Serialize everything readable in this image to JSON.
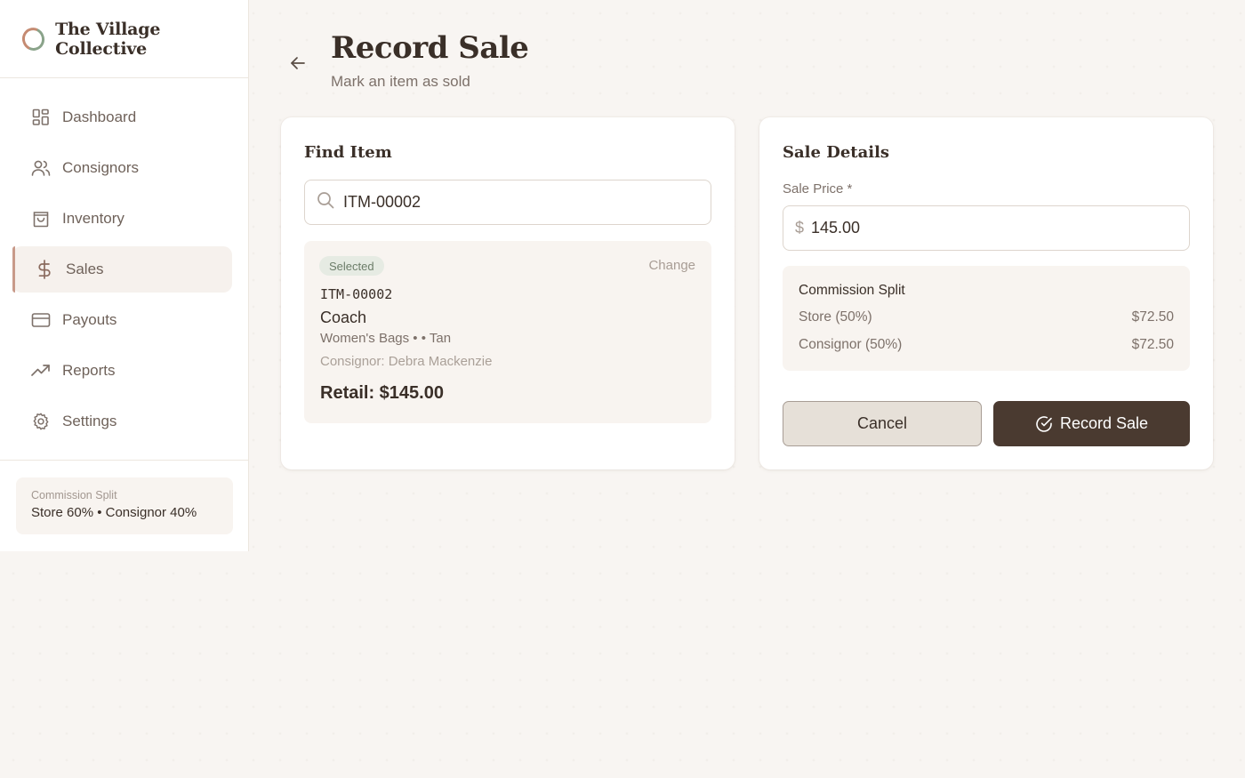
{
  "brand": {
    "name": "The Village Collective"
  },
  "nav": {
    "items": [
      {
        "label": "Dashboard",
        "icon": "dashboard-icon"
      },
      {
        "label": "Consignors",
        "icon": "users-icon"
      },
      {
        "label": "Inventory",
        "icon": "shopping-bag-icon"
      },
      {
        "label": "Sales",
        "icon": "dollar-icon",
        "active": true
      },
      {
        "label": "Payouts",
        "icon": "credit-card-icon"
      },
      {
        "label": "Reports",
        "icon": "trending-up-icon"
      },
      {
        "label": "Settings",
        "icon": "gear-icon"
      }
    ]
  },
  "sidebar_footer": {
    "label": "Commission Split",
    "value": "Store 60% • Consignor 40%"
  },
  "header": {
    "title": "Record Sale",
    "subtitle": "Mark an item as sold"
  },
  "find_item": {
    "title": "Find Item",
    "search_value": "ITM-00002",
    "selected": {
      "badge": "Selected",
      "change_label": "Change",
      "sku": "ITM-00002",
      "brand": "Coach",
      "meta": "Women's Bags • • Tan",
      "consignor": "Consignor: Debra Mackenzie",
      "retail": "Retail: $145.00"
    }
  },
  "sale_details": {
    "title": "Sale Details",
    "price_label": "Sale Price *",
    "currency_symbol": "$",
    "price_value": "145.00",
    "split": {
      "title": "Commission Split",
      "store_label": "Store (50%)",
      "store_value": "$72.50",
      "consignor_label": "Consignor (50%)",
      "consignor_value": "$72.50"
    },
    "cancel_label": "Cancel",
    "record_label": "Record Sale"
  },
  "colors": {
    "accent": "#4a3a30",
    "background": "#f8f5f2",
    "active_indicator": "#c89a8a",
    "badge_bg": "#e6ebe3"
  }
}
